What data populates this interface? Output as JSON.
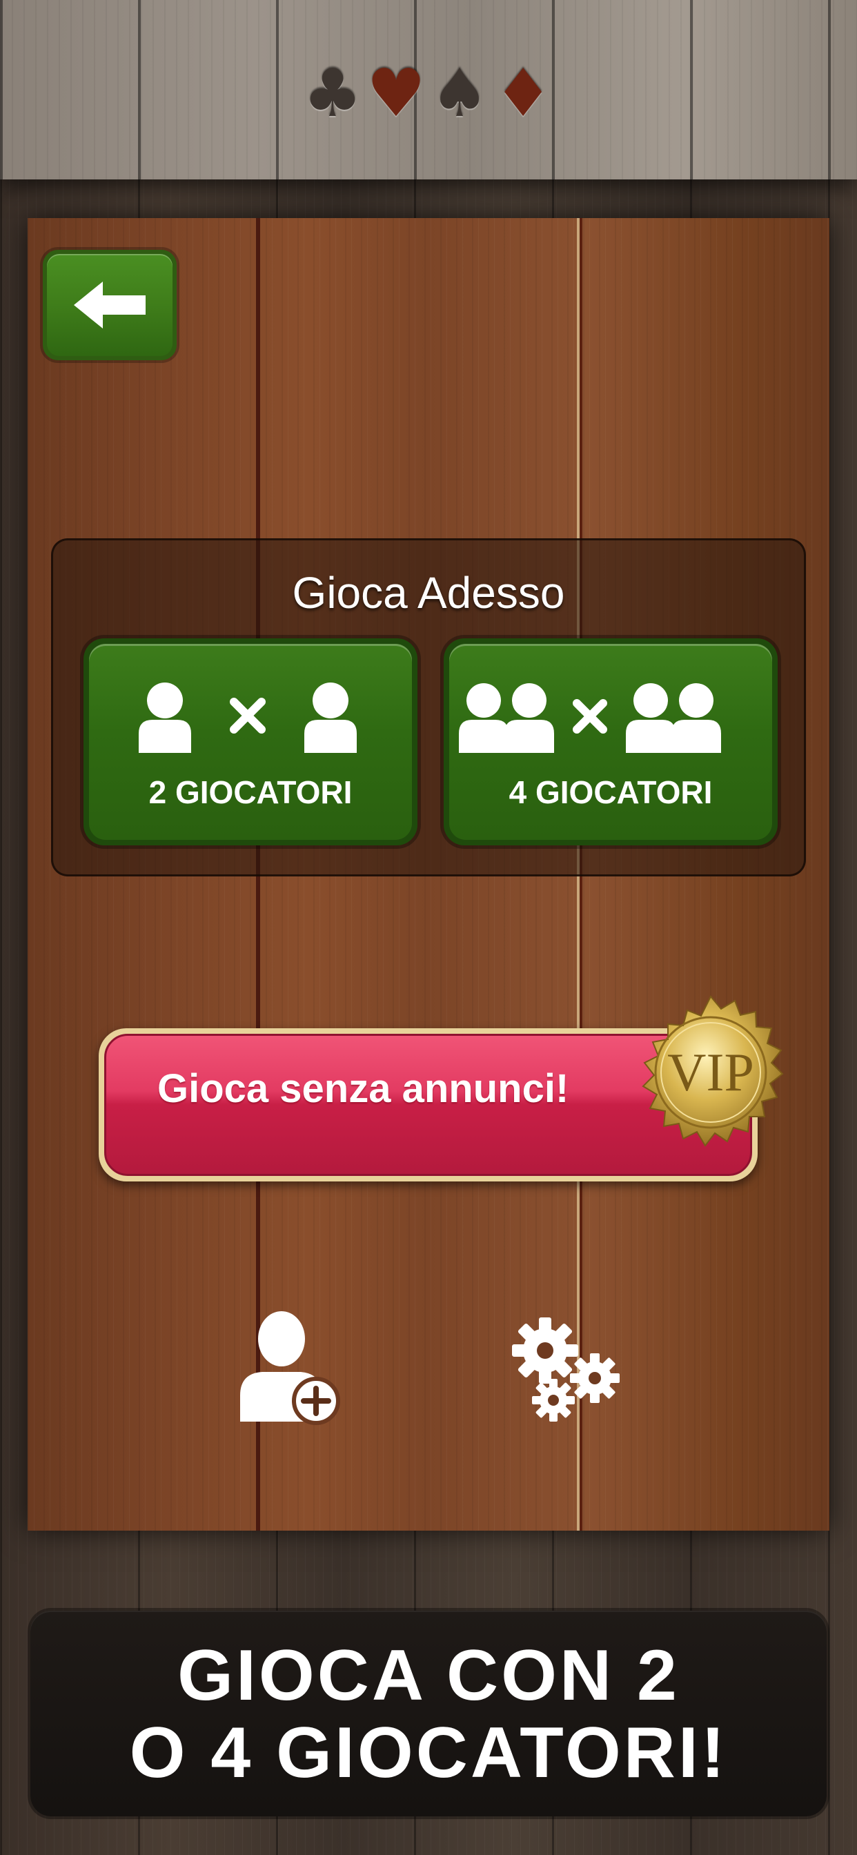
{
  "header": {
    "suits": [
      {
        "icon": "club-icon",
        "glyph": "♣",
        "color": "#3d3530"
      },
      {
        "icon": "heart-icon",
        "glyph": "♥",
        "color": "#6e2412"
      },
      {
        "icon": "spade-icon",
        "glyph": "♠",
        "color": "#3d3530"
      },
      {
        "icon": "diamond-icon",
        "glyph": "♦",
        "color": "#6e2412"
      }
    ]
  },
  "back_button": {
    "icon": "arrow-left-icon"
  },
  "play_panel": {
    "title": "Gioca Adesso",
    "modes": [
      {
        "label": "2 GIOCATORI",
        "icon": "one-vs-one-icon"
      },
      {
        "label": "4 GIOCATORI",
        "icon": "two-vs-two-icon"
      }
    ]
  },
  "vip": {
    "label": "Gioca senza annunci!",
    "seal_text": "VIP",
    "button_color": "#e33b62",
    "seal_color": "#d4b24a"
  },
  "bottom_actions": [
    {
      "icon": "add-player-icon"
    },
    {
      "icon": "settings-gears-icon"
    }
  ],
  "promo": {
    "line1": "GIOCA CON 2",
    "line2": "O 4 GIOCATORI!"
  },
  "colors": {
    "green_button": "#3d7c1b",
    "wood": "#7a4326"
  }
}
